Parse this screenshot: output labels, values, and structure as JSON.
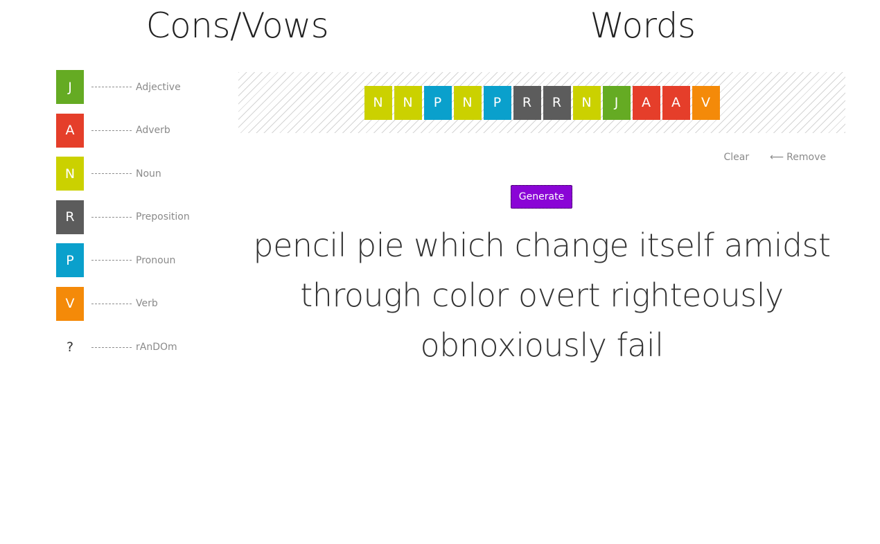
{
  "headings": {
    "left": "Cons/Vows",
    "right": "Words"
  },
  "legend": [
    {
      "letter": "J",
      "label": "Adjective",
      "color": "#65ab23"
    },
    {
      "letter": "A",
      "label": "Adverb",
      "color": "#e53e2a"
    },
    {
      "letter": "N",
      "label": "Noun",
      "color": "#cbd100"
    },
    {
      "letter": "R",
      "label": "Preposition",
      "color": "#5c5c5c"
    },
    {
      "letter": "P",
      "label": "Pronoun",
      "color": "#0aa0cc"
    },
    {
      "letter": "V",
      "label": "Verb",
      "color": "#f48a09"
    },
    {
      "letter": "?",
      "label": "rAnDOm",
      "color": ""
    }
  ],
  "tiles": [
    {
      "letter": "N",
      "color": "#cbd100"
    },
    {
      "letter": "N",
      "color": "#cbd100"
    },
    {
      "letter": "P",
      "color": "#0aa0cc"
    },
    {
      "letter": "N",
      "color": "#cbd100"
    },
    {
      "letter": "P",
      "color": "#0aa0cc"
    },
    {
      "letter": "R",
      "color": "#5c5c5c"
    },
    {
      "letter": "R",
      "color": "#5c5c5c"
    },
    {
      "letter": "N",
      "color": "#cbd100"
    },
    {
      "letter": "J",
      "color": "#65ab23"
    },
    {
      "letter": "A",
      "color": "#e53e2a"
    },
    {
      "letter": "A",
      "color": "#e53e2a"
    },
    {
      "letter": "V",
      "color": "#f48a09"
    }
  ],
  "controls": {
    "clear_label": "Clear",
    "remove_arrow": "⟵",
    "remove_label": "Remove"
  },
  "generate_label": "Generate",
  "generate_color": "#8a05d6",
  "output_text": "pencil pie which change itself amidst through color overt righteously obnoxiously fail"
}
